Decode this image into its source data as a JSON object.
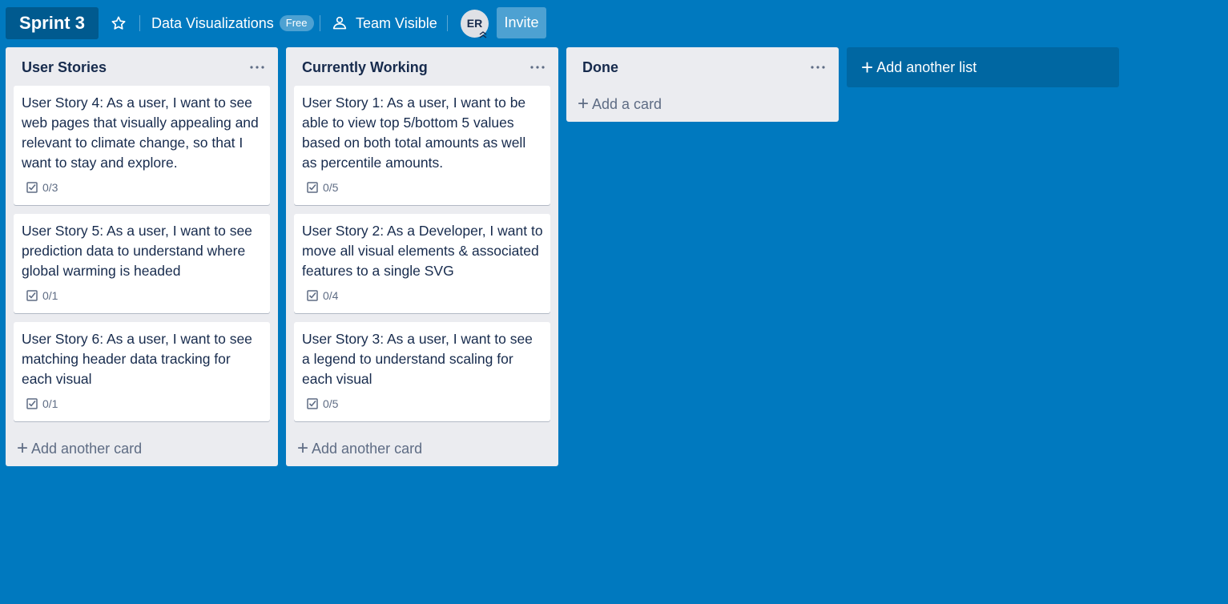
{
  "header": {
    "board_title": "Sprint 3",
    "team_name": "Data Visualizations",
    "team_badge": "Free",
    "visibility": "Team Visible",
    "avatar_initials": "ER",
    "invite_label": "Invite"
  },
  "lists": [
    {
      "title": "User Stories",
      "cards": [
        {
          "text": "User Story 4: As a user, I want to see web pages that visually appealing and relevant to climate change, so that I want to stay and explore.",
          "checklist": "0/3"
        },
        {
          "text": "User Story 5: As a user, I want to see prediction data to understand where global warming is headed",
          "checklist": "0/1"
        },
        {
          "text": "User Story 6: As a user, I want to see matching header data tracking for each visual",
          "checklist": "0/1"
        }
      ],
      "add_label": "Add another card"
    },
    {
      "title": "Currently Working",
      "cards": [
        {
          "text": "User Story 1: As a user, I want to be able to view top 5/bottom 5 values based on both total amounts as well as percentile amounts.",
          "checklist": "0/5"
        },
        {
          "text": "User Story 2: As a Developer, I want to move all visual elements & associated features to a single SVG",
          "checklist": "0/4"
        },
        {
          "text": "User Story 3: As a user, I want to see a legend to understand scaling for each visual",
          "checklist": "0/5"
        }
      ],
      "add_label": "Add another card"
    },
    {
      "title": "Done",
      "cards": [],
      "add_label": "Add a card"
    }
  ],
  "add_list_label": "Add another list",
  "colors": {
    "board_background": "#0079bf",
    "list_background": "#ebecf0",
    "card_background": "#ffffff",
    "text_primary": "#172b4d",
    "text_secondary": "#5e6c84"
  }
}
